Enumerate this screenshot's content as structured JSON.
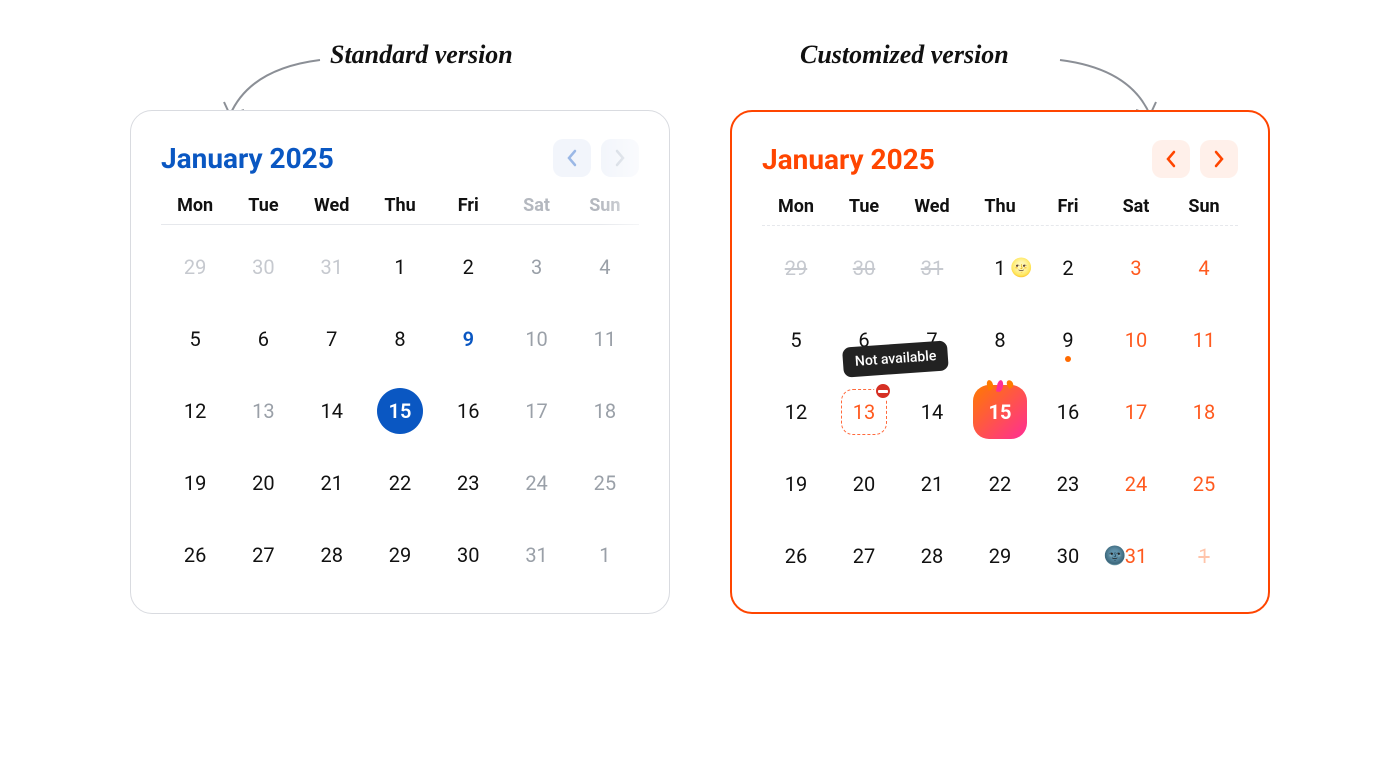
{
  "labels": {
    "standard": "Standard version",
    "custom": "Customized version"
  },
  "weekdays": [
    "Mon",
    "Tue",
    "Wed",
    "Thu",
    "Fri",
    "Sat",
    "Sun"
  ],
  "accent_colors": {
    "standard": "#0a57c2",
    "custom": "#ff4500"
  },
  "standard": {
    "title": "January 2025",
    "cells": [
      {
        "n": "29",
        "cls": "other"
      },
      {
        "n": "30",
        "cls": "other"
      },
      {
        "n": "31",
        "cls": "other"
      },
      {
        "n": "1"
      },
      {
        "n": "2"
      },
      {
        "n": "3",
        "cls": "weekend"
      },
      {
        "n": "4",
        "cls": "weekend"
      },
      {
        "n": "5"
      },
      {
        "n": "6"
      },
      {
        "n": "7"
      },
      {
        "n": "8"
      },
      {
        "n": "9",
        "cls": "highlight"
      },
      {
        "n": "10",
        "cls": "weekend"
      },
      {
        "n": "11",
        "cls": "weekend"
      },
      {
        "n": "12"
      },
      {
        "n": "13",
        "cls": "weekend"
      },
      {
        "n": "14"
      },
      {
        "n": "15",
        "cls": "selected"
      },
      {
        "n": "16"
      },
      {
        "n": "17",
        "cls": "weekend"
      },
      {
        "n": "18",
        "cls": "weekend"
      },
      {
        "n": "19"
      },
      {
        "n": "20"
      },
      {
        "n": "21"
      },
      {
        "n": "22"
      },
      {
        "n": "23"
      },
      {
        "n": "24",
        "cls": "weekend"
      },
      {
        "n": "25",
        "cls": "weekend"
      },
      {
        "n": "26"
      },
      {
        "n": "27"
      },
      {
        "n": "28"
      },
      {
        "n": "29"
      },
      {
        "n": "30"
      },
      {
        "n": "31",
        "cls": "weekend"
      },
      {
        "n": "1",
        "cls": "other weekend"
      }
    ]
  },
  "custom": {
    "title": "January 2025",
    "tooltip": "Not available",
    "cells": [
      {
        "n": "29",
        "cls": "other"
      },
      {
        "n": "30",
        "cls": "other"
      },
      {
        "n": "31",
        "cls": "other"
      },
      {
        "n": "1",
        "emoji_after": "🌝"
      },
      {
        "n": "2"
      },
      {
        "n": "3",
        "cls": "weekend"
      },
      {
        "n": "4",
        "cls": "weekend"
      },
      {
        "n": "5"
      },
      {
        "n": "6"
      },
      {
        "n": "7"
      },
      {
        "n": "8"
      },
      {
        "n": "9",
        "dot": true
      },
      {
        "n": "10",
        "cls": "weekend"
      },
      {
        "n": "11",
        "cls": "weekend"
      },
      {
        "n": "12"
      },
      {
        "n": "13",
        "cls": "dashed",
        "tooltip": true,
        "no_entry": true
      },
      {
        "n": "14"
      },
      {
        "n": "15",
        "cls": "fire"
      },
      {
        "n": "16"
      },
      {
        "n": "17",
        "cls": "weekend"
      },
      {
        "n": "18",
        "cls": "weekend"
      },
      {
        "n": "19"
      },
      {
        "n": "20"
      },
      {
        "n": "21"
      },
      {
        "n": "22"
      },
      {
        "n": "23"
      },
      {
        "n": "24",
        "cls": "weekend"
      },
      {
        "n": "25",
        "cls": "weekend"
      },
      {
        "n": "26"
      },
      {
        "n": "27"
      },
      {
        "n": "28"
      },
      {
        "n": "29"
      },
      {
        "n": "30"
      },
      {
        "n": "31",
        "cls": "weekend",
        "emoji_before": "🌚"
      },
      {
        "n": "1",
        "cls": "other weekend"
      }
    ]
  }
}
